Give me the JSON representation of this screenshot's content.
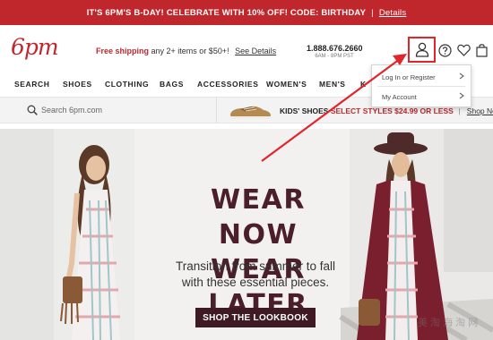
{
  "promo": {
    "text": "IT'S 6PM'S B-DAY! CELEBRATE WITH 10% OFF! CODE: BIRTHDAY",
    "separator": "|",
    "link": "Details"
  },
  "header": {
    "logo": "6pm",
    "shipping_highlight": "Free shipping",
    "shipping_rest": "any 2+ items or $50+!",
    "shipping_link": "See Details",
    "phone": "1.888.676.2660",
    "hours": "6AM - 8PM PST"
  },
  "icons": {
    "user": "user-icon",
    "help": "question-icon",
    "wishlist": "heart-icon",
    "bag": "shopping-bag-icon",
    "search": "search-icon"
  },
  "nav": {
    "items": [
      "SEARCH",
      "SHOES",
      "CLOTHING",
      "BAGS",
      "ACCESSORIES",
      "WOMEN'S",
      "MEN'S",
      "K"
    ]
  },
  "search": {
    "placeholder": "Search 6pm.com"
  },
  "kids_promo": {
    "label": "KIDS' SHOES",
    "offer": "SELECT STYLES $24.99 OR LESS",
    "separator": "|",
    "link": "Shop Now"
  },
  "hero": {
    "title_line1": "WEAR NOW",
    "title_line2": "WEAR LATER",
    "subtitle_line1": "Transition from summer to fall",
    "subtitle_line2": "with these essential pieces.",
    "cta": "SHOP THE LOOKBOOK"
  },
  "account_menu": {
    "items": [
      "Log In or Register",
      "My Account"
    ]
  },
  "watermark": "美 淘 海 淘 网",
  "colors": {
    "brand_red": "#c0272d",
    "hero_text": "#4a1e2a",
    "cta_bg": "#3f1a24",
    "highlight_box": "#e0252d"
  }
}
